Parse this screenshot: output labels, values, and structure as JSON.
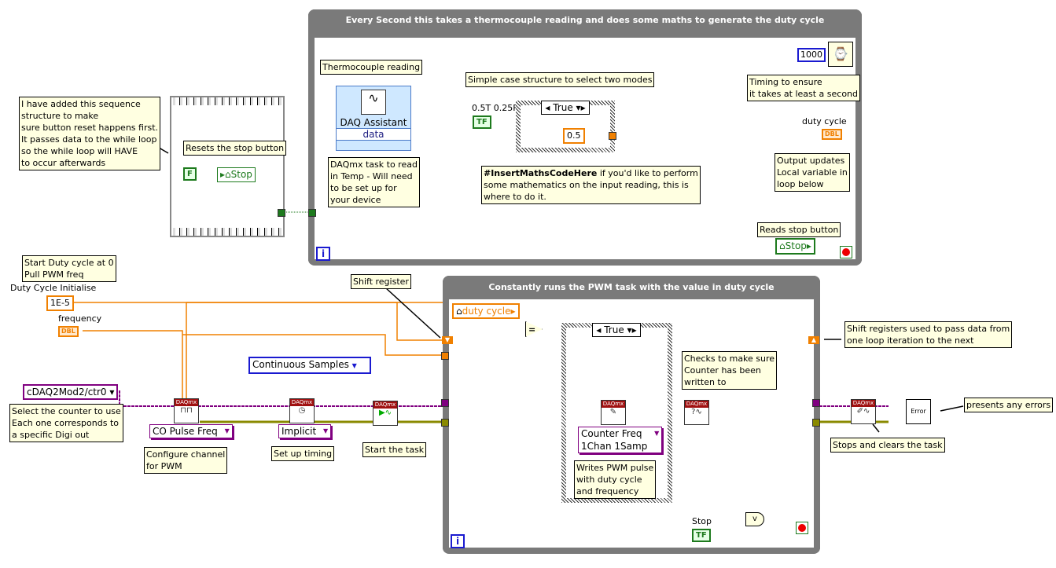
{
  "top_loop": {
    "title": "Every Second this takes a thermocouple reading and does some maths to generate the duty cycle",
    "iteration_icon": "i"
  },
  "bottom_loop": {
    "title": "Constantly runs the PWM task with the value in duty cycle",
    "iteration_icon": "i"
  },
  "notes": {
    "sequence": "I have added this sequence\nstructure to make\nsure button reset happens first.\nIt passes data to the while loop\nso the while loop will HAVE\nto occur afterwards",
    "resets": "Resets the stop button",
    "thermo": "Thermocouple reading",
    "daqmx_task": "DAQmx task to read\nin Temp - Will need\nto be set up for\nyour device",
    "case_simple": "Simple case structure to select two modes",
    "maths_bold": "#InsertMathsCodeHere",
    "maths_rest": " if you'd like to perform\nsome mathematics on the input reading, this is\nwhere to do it.",
    "timing": "Timing to ensure\nit takes at least a second",
    "output_updates": "Output updates\nLocal variable in\nloop below",
    "reads_stop": "Reads stop button",
    "start_duty": "Start Duty cycle at 0\nPull PWM freq",
    "shift_register": "Shift register",
    "shift_registers_pass": "Shift registers used to pass data from\none loop iteration to the next",
    "checks_counter": "Checks to make sure\nCounter has been\nwritten to",
    "writes_pwm": "Writes PWM pulse\nwith duty cycle\nand frequency",
    "select_counter": "Select the counter to use\nEach one corresponds to\na specific Digi out",
    "configure_channel": "Configure channel\nfor PWM",
    "setup_timing": "Set up timing",
    "start_task": "Start the task",
    "stops_clears": "Stops and clears the task",
    "presents_errors": "presents any errors"
  },
  "labels": {
    "mode_label": "0.5T 0.25F",
    "duty_cycle": "duty cycle",
    "duty_init": "Duty Cycle Initialise",
    "frequency": "frequency",
    "stop": "Stop",
    "daq_assistant": "DAQ Assistant",
    "daq_data": "data"
  },
  "constants": {
    "false_const": "F",
    "stop_local": "Stop",
    "tf": "TF",
    "case_true": "True",
    "half": "0.5",
    "wait_ms": "1000",
    "duty_init": "1E-5",
    "dbl": "DBL",
    "duty_local": "duty cycle",
    "counter": "cDAQ2Mod2/ctr0",
    "equals": "="
  },
  "rings": {
    "co_pulse": "CO Pulse Freq",
    "implicit": "Implicit",
    "continuous": "Continuous Samples",
    "counter_freq": "Counter Freq\n1Chan 1Samp"
  },
  "daqmx": {
    "header": "DAQmx"
  },
  "error_icon": "Error",
  "colors": {
    "loop_border": "#7a7a7a",
    "note_bg": "#ffffe1",
    "double_wire": "#f08000",
    "bool_wire": "#1d7a1d",
    "task_wire": "#800080",
    "error_wire": "#c8c800"
  }
}
